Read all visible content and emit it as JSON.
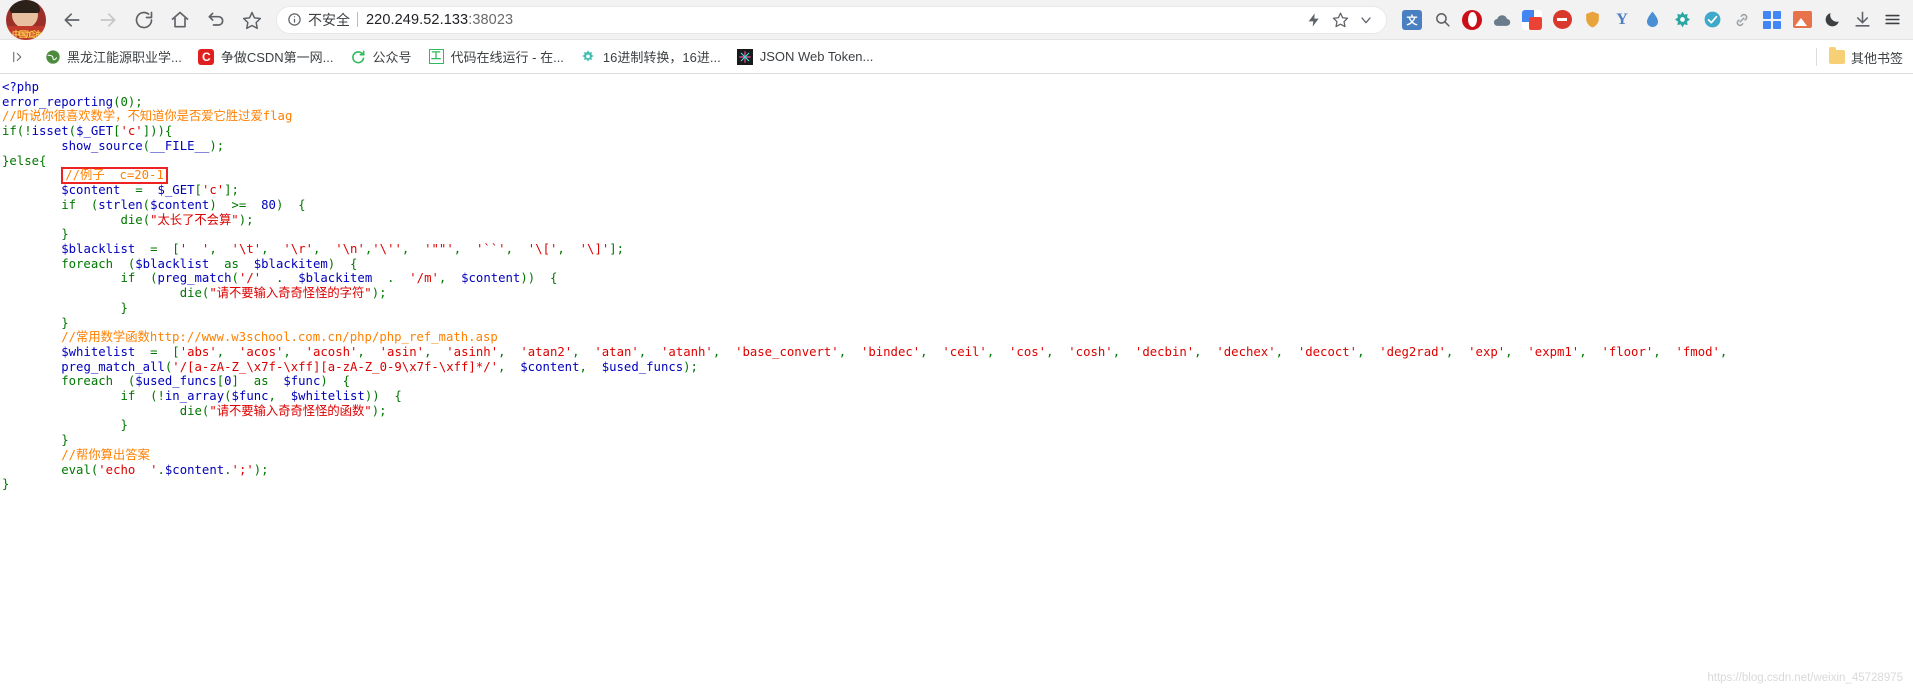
{
  "window": {
    "profile_name": "中国加油"
  },
  "toolbar": {
    "back_label": "Back",
    "forward_label": "Forward",
    "reload_label": "Reload",
    "home_label": "Home",
    "history_back_label": "History",
    "bookmark_star_label": "Bookmark",
    "security_text": "不安全",
    "url": "220.249.52.133:38023",
    "url_host": "220.249.52.133",
    "url_port": ":38023",
    "omnibox_icons": [
      "lightning-icon",
      "star-icon",
      "chevron-down-icon"
    ],
    "extension_icons": [
      "translate-icon",
      "search-icon",
      "opera-icon",
      "cloud-icon",
      "google-translate-icon",
      "adblock-icon",
      "shield-icon",
      "yandex-icon",
      "water-drop-icon",
      "puzzle-icon",
      "check-circle-icon",
      "link-icon",
      "grid-icon",
      "image-icon",
      "moon-icon",
      "download-icon",
      "menu-icon"
    ]
  },
  "bookmarks": {
    "apps_label": "Apps",
    "items": [
      {
        "icon": "globe-icon",
        "label": "黑龙江能源职业学..."
      },
      {
        "icon": "csdn-icon",
        "label": "争做CSDN第一网..."
      },
      {
        "icon": "wechat-icon",
        "label": "公众号"
      },
      {
        "icon": "tool-icon",
        "label": "代码在线运行 - 在..."
      },
      {
        "icon": "gear-icon",
        "label": "16进制转换，16进..."
      },
      {
        "icon": "snowflake-icon",
        "label": "JSON Web Token..."
      }
    ],
    "other_bookmarks_label": "其他书签",
    "other_bookmarks_icon": "folder-icon"
  },
  "page": {
    "watermark": "https://blog.csdn.net/weixin_45728975",
    "highlight_color": "#ee2222",
    "colors": {
      "keyword": "#007700",
      "variable": "#0000bb",
      "string": "#dd0000",
      "comment": "#ff8000",
      "background": "#ffffff"
    },
    "code_lines": [
      {
        "id": "l1",
        "tokens": [
          {
            "t": "<?php",
            "c": "var"
          }
        ]
      },
      {
        "id": "l2",
        "tokens": [
          {
            "t": "error_reporting",
            "c": "var"
          },
          {
            "t": "(0)",
            "c": "kw"
          },
          {
            "t": ";",
            "c": "kw"
          }
        ]
      },
      {
        "id": "l3",
        "tokens": [
          {
            "t": "//听说你很喜欢数学，不知道你是否爱它胜过爱flag",
            "c": "cmt"
          }
        ]
      },
      {
        "id": "l4",
        "tokens": [
          {
            "t": "if(!",
            "c": "kw"
          },
          {
            "t": "isset",
            "c": "var"
          },
          {
            "t": "(",
            "c": "kw"
          },
          {
            "t": "$_GET",
            "c": "var"
          },
          {
            "t": "[",
            "c": "kw"
          },
          {
            "t": "'c'",
            "c": "str"
          },
          {
            "t": "])){",
            "c": "kw"
          }
        ]
      },
      {
        "id": "l5",
        "tokens": [
          {
            "t": "        ",
            "c": "kw"
          },
          {
            "t": "show_source",
            "c": "var"
          },
          {
            "t": "(",
            "c": "kw"
          },
          {
            "t": "__FILE__",
            "c": "var"
          },
          {
            "t": ");",
            "c": "kw"
          }
        ]
      },
      {
        "id": "l6",
        "tokens": [
          {
            "t": "}else{",
            "c": "kw"
          }
        ]
      },
      {
        "id": "l7",
        "highlight": true,
        "tokens": [
          {
            "t": "        ",
            "c": "kw"
          },
          {
            "t": "//例子  c=20-1",
            "c": "cmt"
          }
        ]
      },
      {
        "id": "l8",
        "tokens": [
          {
            "t": "        ",
            "c": "kw"
          },
          {
            "t": "$content",
            "c": "var"
          },
          {
            "t": "  =  ",
            "c": "kw"
          },
          {
            "t": "$_GET",
            "c": "var"
          },
          {
            "t": "[",
            "c": "kw"
          },
          {
            "t": "'c'",
            "c": "str"
          },
          {
            "t": "];",
            "c": "kw"
          }
        ]
      },
      {
        "id": "l9",
        "tokens": [
          {
            "t": "        if  (",
            "c": "kw"
          },
          {
            "t": "strlen",
            "c": "var"
          },
          {
            "t": "(",
            "c": "kw"
          },
          {
            "t": "$content",
            "c": "var"
          },
          {
            "t": ")  >=  ",
            "c": "kw"
          },
          {
            "t": "80",
            "c": "var"
          },
          {
            "t": ")  {",
            "c": "kw"
          }
        ]
      },
      {
        "id": "l10",
        "tokens": [
          {
            "t": "                ",
            "c": "kw"
          },
          {
            "t": "die",
            "c": "kw"
          },
          {
            "t": "(",
            "c": "kw"
          },
          {
            "t": "\"太长了不会算\"",
            "c": "str"
          },
          {
            "t": ");",
            "c": "kw"
          }
        ]
      },
      {
        "id": "l11",
        "tokens": [
          {
            "t": "        }",
            "c": "kw"
          }
        ]
      },
      {
        "id": "l12",
        "tokens": [
          {
            "t": "        ",
            "c": "kw"
          },
          {
            "t": "$blacklist",
            "c": "var"
          },
          {
            "t": "  =  [",
            "c": "kw"
          },
          {
            "t": "'  '",
            "c": "str"
          },
          {
            "t": ",  ",
            "c": "kw"
          },
          {
            "t": "'\\t'",
            "c": "str"
          },
          {
            "t": ",  ",
            "c": "kw"
          },
          {
            "t": "'\\r'",
            "c": "str"
          },
          {
            "t": ",  ",
            "c": "kw"
          },
          {
            "t": "'\\n'",
            "c": "str"
          },
          {
            "t": ",",
            "c": "kw"
          },
          {
            "t": "'\\''",
            "c": "str"
          },
          {
            "t": ",  ",
            "c": "kw"
          },
          {
            "t": "'\"\"'",
            "c": "str"
          },
          {
            "t": ",  ",
            "c": "kw"
          },
          {
            "t": "'``'",
            "c": "str"
          },
          {
            "t": ",  ",
            "c": "kw"
          },
          {
            "t": "'\\['",
            "c": "str"
          },
          {
            "t": ",  ",
            "c": "kw"
          },
          {
            "t": "'\\]'",
            "c": "str"
          },
          {
            "t": "];",
            "c": "kw"
          }
        ]
      },
      {
        "id": "l13",
        "tokens": [
          {
            "t": "        foreach  (",
            "c": "kw"
          },
          {
            "t": "$blacklist",
            "c": "var"
          },
          {
            "t": "  as  ",
            "c": "kw"
          },
          {
            "t": "$blackitem",
            "c": "var"
          },
          {
            "t": ")  {",
            "c": "kw"
          }
        ]
      },
      {
        "id": "l14",
        "tokens": [
          {
            "t": "                if  (",
            "c": "kw"
          },
          {
            "t": "preg_match",
            "c": "var"
          },
          {
            "t": "(",
            "c": "kw"
          },
          {
            "t": "'/'",
            "c": "str"
          },
          {
            "t": "  .  ",
            "c": "kw"
          },
          {
            "t": "$blackitem",
            "c": "var"
          },
          {
            "t": "  .  ",
            "c": "kw"
          },
          {
            "t": "'/m'",
            "c": "str"
          },
          {
            "t": ",  ",
            "c": "kw"
          },
          {
            "t": "$content",
            "c": "var"
          },
          {
            "t": "))  {",
            "c": "kw"
          }
        ]
      },
      {
        "id": "l15",
        "tokens": [
          {
            "t": "                        ",
            "c": "kw"
          },
          {
            "t": "die",
            "c": "kw"
          },
          {
            "t": "(",
            "c": "kw"
          },
          {
            "t": "\"请不要输入奇奇怪怪的字符\"",
            "c": "str"
          },
          {
            "t": ");",
            "c": "kw"
          }
        ]
      },
      {
        "id": "l16",
        "tokens": [
          {
            "t": "                }",
            "c": "kw"
          }
        ]
      },
      {
        "id": "l17",
        "tokens": [
          {
            "t": "        }",
            "c": "kw"
          }
        ]
      },
      {
        "id": "l18",
        "tokens": [
          {
            "t": "        ",
            "c": "kw"
          },
          {
            "t": "//常用数学函数http://www.w3school.com.cn/php/php_ref_math.asp",
            "c": "cmt"
          }
        ]
      },
      {
        "id": "l19",
        "tokens": [
          {
            "t": "        ",
            "c": "kw"
          },
          {
            "t": "$whitelist",
            "c": "var"
          },
          {
            "t": "  =  [",
            "c": "kw"
          },
          {
            "t": "'abs'",
            "c": "str"
          },
          {
            "t": ",  ",
            "c": "kw"
          },
          {
            "t": "'acos'",
            "c": "str"
          },
          {
            "t": ",  ",
            "c": "kw"
          },
          {
            "t": "'acosh'",
            "c": "str"
          },
          {
            "t": ",  ",
            "c": "kw"
          },
          {
            "t": "'asin'",
            "c": "str"
          },
          {
            "t": ",  ",
            "c": "kw"
          },
          {
            "t": "'asinh'",
            "c": "str"
          },
          {
            "t": ",  ",
            "c": "kw"
          },
          {
            "t": "'atan2'",
            "c": "str"
          },
          {
            "t": ",  ",
            "c": "kw"
          },
          {
            "t": "'atan'",
            "c": "str"
          },
          {
            "t": ",  ",
            "c": "kw"
          },
          {
            "t": "'atanh'",
            "c": "str"
          },
          {
            "t": ",  ",
            "c": "kw"
          },
          {
            "t": "'base_convert'",
            "c": "str"
          },
          {
            "t": ",  ",
            "c": "kw"
          },
          {
            "t": "'bindec'",
            "c": "str"
          },
          {
            "t": ",  ",
            "c": "kw"
          },
          {
            "t": "'ceil'",
            "c": "str"
          },
          {
            "t": ",  ",
            "c": "kw"
          },
          {
            "t": "'cos'",
            "c": "str"
          },
          {
            "t": ",  ",
            "c": "kw"
          },
          {
            "t": "'cosh'",
            "c": "str"
          },
          {
            "t": ",  ",
            "c": "kw"
          },
          {
            "t": "'decbin'",
            "c": "str"
          },
          {
            "t": ",  ",
            "c": "kw"
          },
          {
            "t": "'dechex'",
            "c": "str"
          },
          {
            "t": ",  ",
            "c": "kw"
          },
          {
            "t": "'decoct'",
            "c": "str"
          },
          {
            "t": ",  ",
            "c": "kw"
          },
          {
            "t": "'deg2rad'",
            "c": "str"
          },
          {
            "t": ",  ",
            "c": "kw"
          },
          {
            "t": "'exp'",
            "c": "str"
          },
          {
            "t": ",  ",
            "c": "kw"
          },
          {
            "t": "'expm1'",
            "c": "str"
          },
          {
            "t": ",  ",
            "c": "kw"
          },
          {
            "t": "'floor'",
            "c": "str"
          },
          {
            "t": ",  ",
            "c": "kw"
          },
          {
            "t": "'fmod'",
            "c": "str"
          },
          {
            "t": ",",
            "c": "kw"
          }
        ]
      },
      {
        "id": "l20",
        "tokens": [
          {
            "t": "        ",
            "c": "kw"
          },
          {
            "t": "preg_match_all",
            "c": "var"
          },
          {
            "t": "(",
            "c": "kw"
          },
          {
            "t": "'/[a-zA-Z_\\x7f-\\xff][a-zA-Z_0-9\\x7f-\\xff]*/'",
            "c": "str"
          },
          {
            "t": ",  ",
            "c": "kw"
          },
          {
            "t": "$content",
            "c": "var"
          },
          {
            "t": ",  ",
            "c": "kw"
          },
          {
            "t": "$used_funcs",
            "c": "var"
          },
          {
            "t": ");",
            "c": "kw"
          }
        ]
      },
      {
        "id": "l21",
        "tokens": [
          {
            "t": "        foreach  (",
            "c": "kw"
          },
          {
            "t": "$used_funcs",
            "c": "var"
          },
          {
            "t": "[",
            "c": "kw"
          },
          {
            "t": "0",
            "c": "var"
          },
          {
            "t": "]  as  ",
            "c": "kw"
          },
          {
            "t": "$func",
            "c": "var"
          },
          {
            "t": ")  {",
            "c": "kw"
          }
        ]
      },
      {
        "id": "l22",
        "tokens": [
          {
            "t": "                if  (!",
            "c": "kw"
          },
          {
            "t": "in_array",
            "c": "var"
          },
          {
            "t": "(",
            "c": "kw"
          },
          {
            "t": "$func",
            "c": "var"
          },
          {
            "t": ",  ",
            "c": "kw"
          },
          {
            "t": "$whitelist",
            "c": "var"
          },
          {
            "t": "))  {",
            "c": "kw"
          }
        ]
      },
      {
        "id": "l23",
        "tokens": [
          {
            "t": "                        ",
            "c": "kw"
          },
          {
            "t": "die",
            "c": "kw"
          },
          {
            "t": "(",
            "c": "kw"
          },
          {
            "t": "\"请不要输入奇奇怪怪的函数\"",
            "c": "str"
          },
          {
            "t": ");",
            "c": "kw"
          }
        ]
      },
      {
        "id": "l24",
        "tokens": [
          {
            "t": "                }",
            "c": "kw"
          }
        ]
      },
      {
        "id": "l25",
        "tokens": [
          {
            "t": "        }",
            "c": "kw"
          }
        ]
      },
      {
        "id": "l26",
        "tokens": [
          {
            "t": "        ",
            "c": "kw"
          },
          {
            "t": "//帮你算出答案",
            "c": "cmt"
          }
        ]
      },
      {
        "id": "l27",
        "tokens": [
          {
            "t": "        ",
            "c": "kw"
          },
          {
            "t": "eval",
            "c": "kw"
          },
          {
            "t": "(",
            "c": "kw"
          },
          {
            "t": "'echo  '",
            "c": "str"
          },
          {
            "t": ".",
            "c": "kw"
          },
          {
            "t": "$content",
            "c": "var"
          },
          {
            "t": ".",
            "c": "kw"
          },
          {
            "t": "';'",
            "c": "str"
          },
          {
            "t": ");",
            "c": "kw"
          }
        ]
      },
      {
        "id": "l28",
        "tokens": [
          {
            "t": "}",
            "c": "kw"
          }
        ]
      }
    ]
  }
}
